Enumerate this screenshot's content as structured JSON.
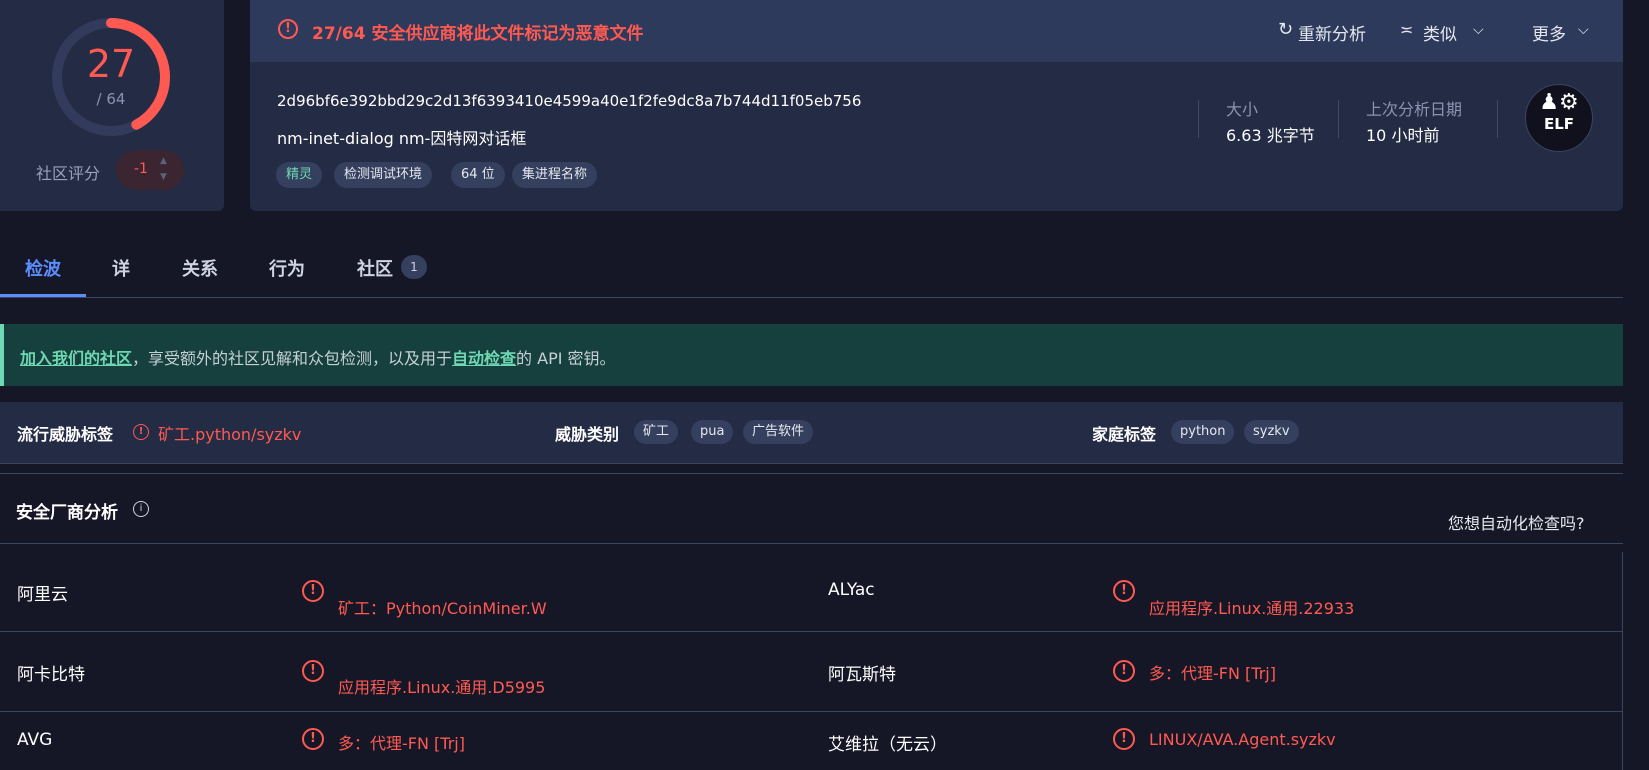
{
  "score": {
    "detected": "27",
    "total": "/ 64",
    "fraction": 0.421875,
    "color": "#ff5a52"
  },
  "community": {
    "label": "社区评分",
    "value": "-1",
    "up_icon": "chevron-up-icon",
    "down_icon": "chevron-down-icon"
  },
  "header": {
    "alert": "27/64 安全供应商将此文件标记为恶意文件",
    "actions": {
      "reanalyze": "重新分析",
      "similar": "类似",
      "more": "更多"
    }
  },
  "file": {
    "hash": "2d96bf6e392bbd29c2d13f6393410e4599a40e1f2fe9dc8a7b744d11f05eb756",
    "name": "nm-inet-dialog nm-因特网对话框",
    "tags": [
      "精灵",
      "检测调试环境",
      "64 位",
      "集进程名称"
    ],
    "size_label": "大小",
    "size_value": "6.63 兆字节",
    "date_label": "上次分析日期",
    "date_value": "10 小时前",
    "type_badge": "ELF"
  },
  "tabs": [
    "检波",
    "详",
    "关系",
    "行为",
    "社区"
  ],
  "tab_badge": "1",
  "banner": {
    "link1": "加入我们的社区",
    "text1": "，享受额外的社区见解和众包检测，以及用于",
    "link2": "自动检查",
    "text2": "的 API 密钥。"
  },
  "threat": {
    "popular_label": "流行威胁标签",
    "popular_value": "矿工.python/syzkv",
    "category_label": "威胁类别",
    "categories": [
      "矿工",
      "pua",
      "广告软件"
    ],
    "family_label": "家庭标签",
    "families": [
      "python",
      "syzkv"
    ]
  },
  "vendors": {
    "title": "安全厂商分析",
    "automation": "您想自动化检查吗?",
    "rows": [
      {
        "left_name": "阿里云",
        "left_result": "矿工：Python/CoinMiner.W",
        "right_name": "ALYac",
        "right_result": "应用程序.Linux.通用.22933"
      },
      {
        "left_name": "阿卡比特",
        "left_result": "应用程序.Linux.通用.D5995",
        "right_name": "阿瓦斯特",
        "right_result": "多：代理-FN [Trj]"
      },
      {
        "left_name": "AVG",
        "left_result": "多：代理-FN [Trj]",
        "right_name": "艾维拉（无云）",
        "right_result": "LINUX/AVA.Agent.syzkv"
      }
    ]
  },
  "colors": {
    "danger": "#ff5a52",
    "accent": "#5b8dff",
    "teal": "#6fd7b2",
    "bg": "#161726",
    "card": "#242b44"
  }
}
